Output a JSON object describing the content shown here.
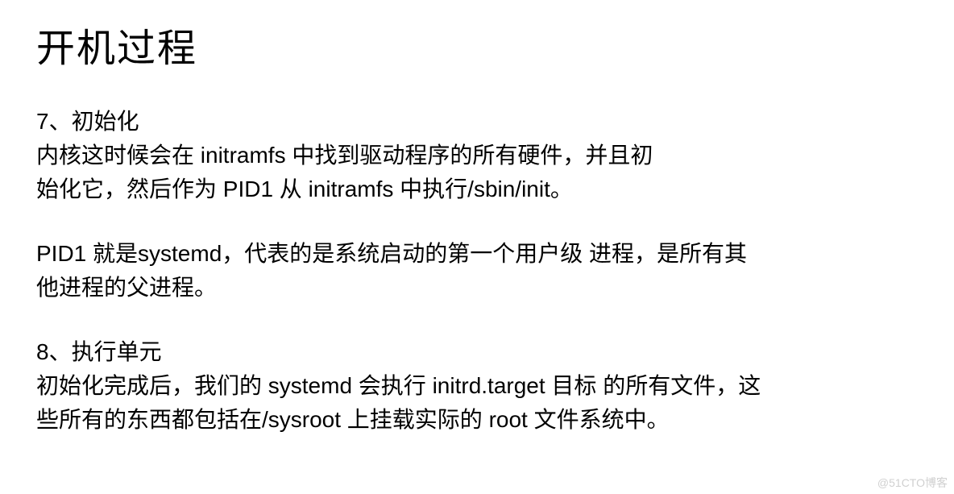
{
  "title": "开机过程",
  "section7": {
    "heading": "7、初始化",
    "line1": "内核这时候会在 initramfs 中找到驱动程序的所有硬件，并且初",
    "line2": "始化它，然后作为 PID1 从 initramfs 中执行/sbin/init。",
    "para2_line1": "PID1 就是systemd，代表的是系统启动的第一个用户级 进程，是所有其",
    "para2_line2": "他进程的父进程。"
  },
  "section8": {
    "heading": "8、执行单元",
    "line1": "初始化完成后，我们的 systemd 会执行 initrd.target 目标 的所有文件，这",
    "line2": "些所有的东西都包括在/sysroot 上挂载实际的 root 文件系统中。"
  },
  "watermark": "@51CTO博客"
}
